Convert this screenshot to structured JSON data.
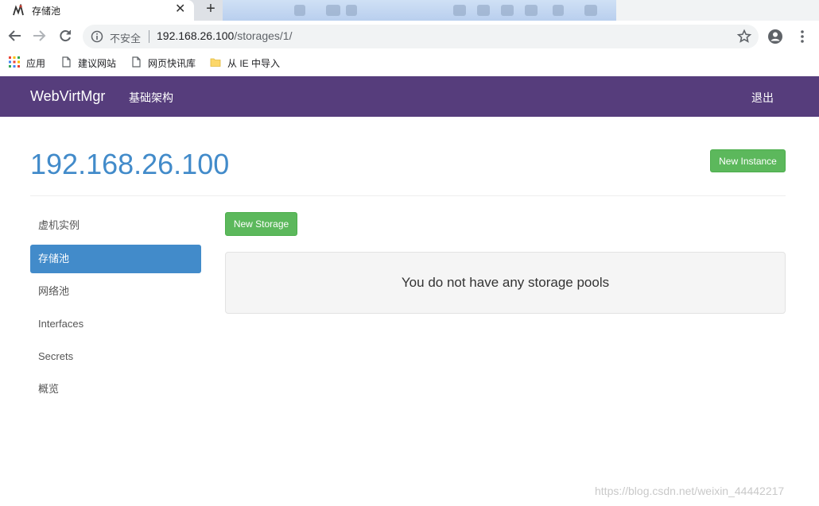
{
  "browser": {
    "tab": {
      "title": "存储池"
    },
    "omnibox": {
      "security_label": "不安全",
      "url_host": "192.168.26.100",
      "url_path": "/storages/1/"
    },
    "bookmarks": [
      {
        "label": "应用",
        "icon": "apps-grid-icon"
      },
      {
        "label": "建议网站",
        "icon": "page-icon"
      },
      {
        "label": "网页快讯库",
        "icon": "page-icon"
      },
      {
        "label": "从 IE 中导入",
        "icon": "folder-icon"
      }
    ]
  },
  "navbar": {
    "brand": "WebVirtMgr",
    "infrastructure_link": "基础架构",
    "logout_link": "退出",
    "color": "#563d7c"
  },
  "page": {
    "title": "192.168.26.100",
    "new_instance_label": "New Instance",
    "new_storage_label": "New Storage",
    "empty_message": "You do not have any storage pools"
  },
  "sidebar": {
    "items": [
      {
        "label": "虚机实例",
        "active": false
      },
      {
        "label": "存储池",
        "active": true
      },
      {
        "label": "网络池",
        "active": false
      },
      {
        "label": "Interfaces",
        "active": false
      },
      {
        "label": "Secrets",
        "active": false
      },
      {
        "label": "概览",
        "active": false
      }
    ]
  },
  "watermark": "https://blog.csdn.net/weixin_44442217",
  "colors": {
    "primary": "#428bca",
    "success": "#5cb85c"
  }
}
